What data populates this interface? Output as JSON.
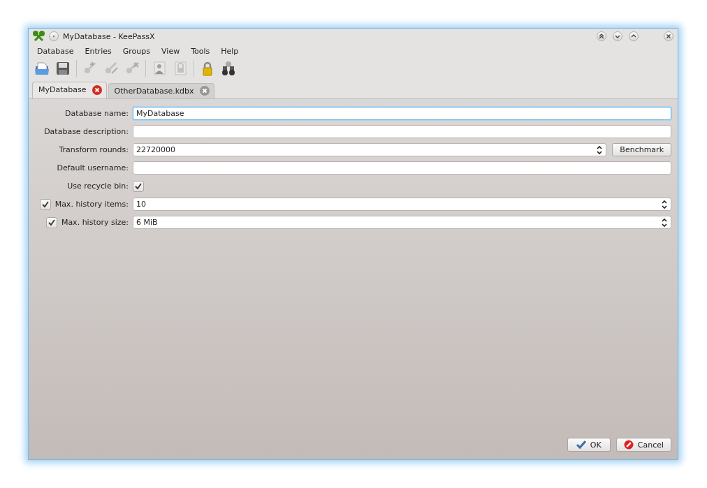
{
  "window": {
    "title": "MyDatabase - KeePassX"
  },
  "menu": [
    "Database",
    "Entries",
    "Groups",
    "View",
    "Tools",
    "Help"
  ],
  "toolbar": [
    [
      {
        "kind": "open",
        "disabled": false
      },
      {
        "kind": "save",
        "disabled": false
      }
    ],
    [
      {
        "kind": "key-add",
        "disabled": true
      },
      {
        "kind": "key-edit",
        "disabled": true
      },
      {
        "kind": "key-delete",
        "disabled": true
      }
    ],
    [
      {
        "kind": "user",
        "disabled": true
      },
      {
        "kind": "padlock-page",
        "disabled": true
      }
    ],
    [
      {
        "kind": "lock",
        "disabled": false
      },
      {
        "kind": "binoculars",
        "disabled": false
      }
    ]
  ],
  "tabs": [
    {
      "label": "MyDatabase",
      "selected": true
    },
    {
      "label": "OtherDatabase.kdbx",
      "selected": false
    }
  ],
  "form": [
    {
      "kind": "text",
      "label": "Database name:",
      "value": "MyDatabase",
      "focused": true
    },
    {
      "kind": "text",
      "label": "Database description:",
      "focused": false
    },
    {
      "kind": "spin",
      "label": "Transform rounds:",
      "value": "22720000",
      "button": "Benchmark"
    },
    {
      "kind": "text",
      "label": "Default username:",
      "focused": false
    },
    {
      "kind": "check",
      "label": "Use recycle bin:",
      "checked": true
    },
    {
      "kind": "spin",
      "label": "Max. history items:",
      "value": "10",
      "enabled": true
    },
    {
      "kind": "spin",
      "label": "Max. history size:",
      "value": "6 MiB",
      "enabled": true
    }
  ],
  "buttons": [
    {
      "kind": "ok",
      "label": "OK"
    },
    {
      "kind": "cancel",
      "label": "Cancel"
    }
  ]
}
